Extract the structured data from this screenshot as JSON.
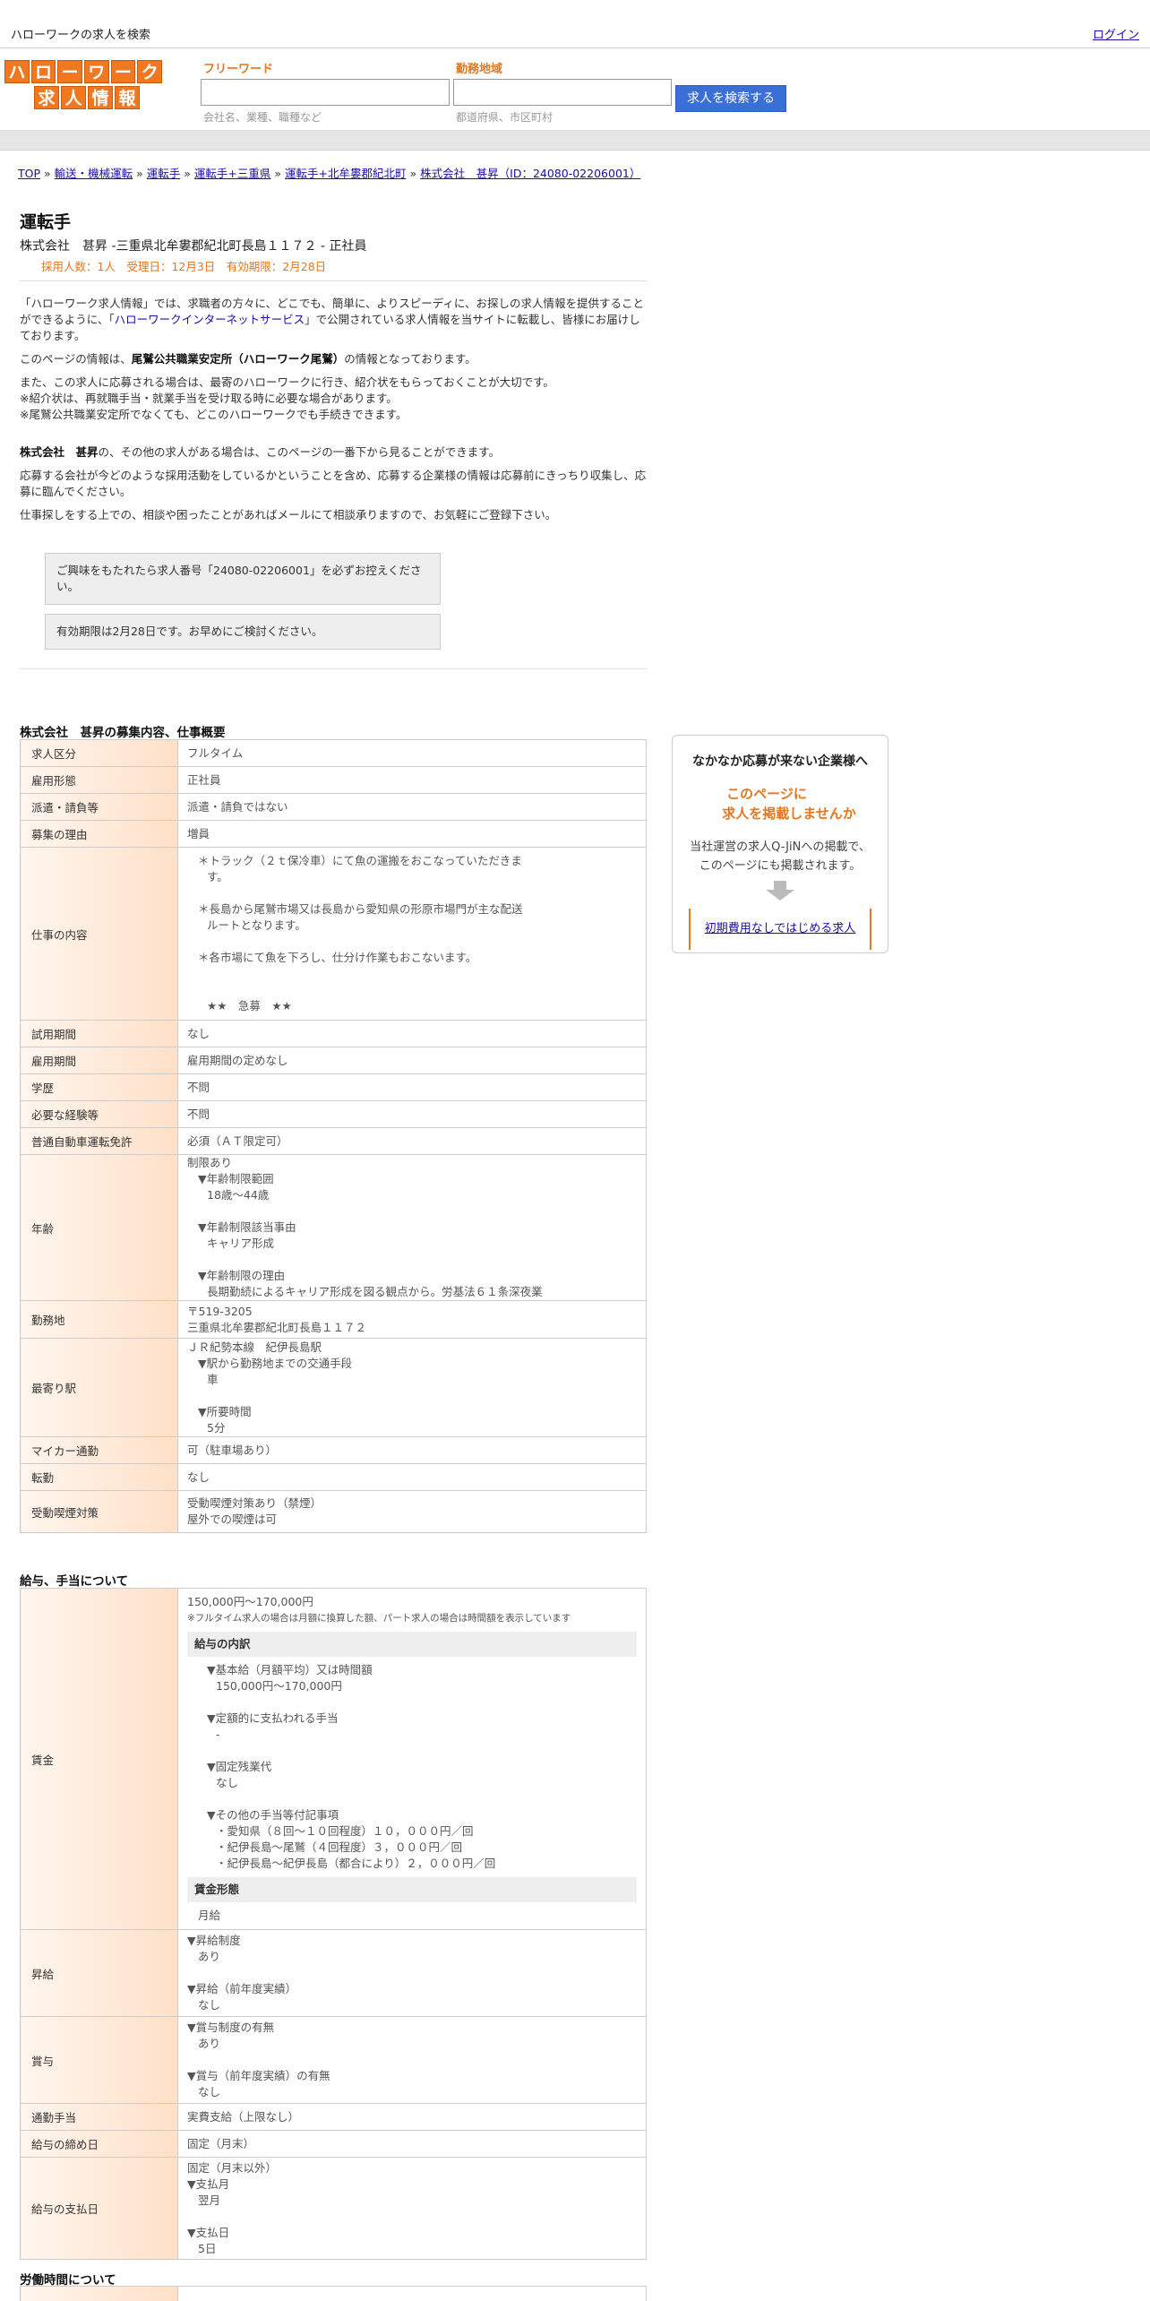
{
  "topbar": {
    "site_title": "ハローワークの求人を検索",
    "login": "ログイン"
  },
  "logo": {
    "row1": [
      "ハ",
      "ロ",
      "ー",
      "ワ",
      "ー",
      "ク"
    ],
    "row2": [
      "求",
      "人",
      "情",
      "報"
    ],
    "color": "#f07821"
  },
  "search": {
    "freeword_label": "フリーワード",
    "freeword_placeholder": "会社名、業種、職種など",
    "area_label": "勤務地域",
    "area_placeholder": "都道府県、市区町村",
    "button": "求人を検索する"
  },
  "breadcrumb": {
    "items": [
      "TOP",
      "輸送・機械運転",
      "運転手",
      "運転手+三重県",
      "運転手+北牟婁郡紀北町",
      "株式会社　甚昇（ID：24080-02206001）"
    ],
    "separator": "»"
  },
  "job": {
    "title": "運転手",
    "subtitle": "株式会社　甚昇 -三重県北牟婁郡紀北町長島１１７２ - 正社員",
    "meta": "採用人数：1人　受理日：12月3日　有効期限：2月28日"
  },
  "intro": {
    "p1_a": "「ハローワーク求人情報」では、求職者の方々に、どこでも、簡単に、よりスピーディに、お探しの求人情報を提供することができるように、「",
    "p1_link": "ハローワークインターネットサービス",
    "p1_b": "」で公開されている求人情報を当サイトに転載し、皆様にお届けしております。",
    "p2_a": "このページの情報は、",
    "p2_b": "尾鷲公共職業安定所（ハローワーク尾鷲）",
    "p2_c": "の情報となっております。",
    "p3_1": "また、この求人に応募される場合は、最寄のハローワークに行き、紹介状をもらっておくことが大切です。",
    "p3_2": "※紹介状は、再就職手当・就業手当を受け取る時に必要な場合があります。",
    "p3_3": "※尾鷲公共職業安定所でなくても、どこのハローワークでも手続きできます。",
    "p4_a": "株式会社　甚昇",
    "p4_b": "の、その他の求人がある場合は、このページの一番下から見ることができます。",
    "p5": "応募する会社が今どのような採用活動をしているかということを含め、応募する企業様の情報は応募前にきっちり収集し、応募に臨んでください。",
    "p6": "仕事探しをする上での、相談や困ったことがあればメールにて相談承りますので、お気軽にご登録下さい。"
  },
  "notes": {
    "n1": "ご興味をもたれたら求人番号「24080-02206001」を必ずお控えください。",
    "n2": "有効期限は2月28日です。お早めにご検討ください。"
  },
  "section1": {
    "title": "株式会社　甚昇の募集内容、仕事概要",
    "rows": {
      "kyujin_kubun": {
        "k": "求人区分",
        "v": "フルタイム"
      },
      "koyo_keitai": {
        "k": "雇用形態",
        "v": "正社員"
      },
      "haken": {
        "k": "派遣・請負等",
        "v": "派遣・請負ではない"
      },
      "riyu": {
        "k": "募集の理由",
        "v": "増員"
      },
      "shigoto": {
        "k": "仕事の内容",
        "l1": "＊トラック（２ｔ保冷車）にて魚の運搬をおこなっていただきま",
        "l2": "す。",
        "l3": "＊長島から尾鷲市場又は長島から愛知県の形原市場門が主な配送",
        "l4": "ルートとなります。",
        "l5": "＊各市場にて魚を下ろし、仕分け作業もおこないます。",
        "l6": "★★　急募　★★"
      },
      "shiyo": {
        "k": "試用期間",
        "v": "なし"
      },
      "koyo_kikan": {
        "k": "雇用期間",
        "v": "雇用期間の定めなし"
      },
      "gakureki": {
        "k": "学歴",
        "v": "不問"
      },
      "keiken": {
        "k": "必要な経験等",
        "v": "不問"
      },
      "menkyo": {
        "k": "普通自動車運転免許",
        "v": "必須（ＡＴ限定可）"
      },
      "nenrei": {
        "k": "年齢",
        "l1": "制限あり",
        "l2": "▼年齢制限範囲",
        "l3": "18歳〜44歳",
        "l4": "▼年齢制限該当事由",
        "l5": "キャリア形成",
        "l6": "▼年齢制限の理由",
        "l7": "長期勤続によるキャリア形成を図る観点から。労基法６１条深夜業"
      },
      "kinmuchi": {
        "k": "勤務地",
        "l1": "〒519-3205",
        "l2": "三重県北牟婁郡紀北町長島１１７２"
      },
      "eki": {
        "k": "最寄り駅",
        "l1": "ＪＲ紀勢本線　紀伊長島駅",
        "l2": "▼駅から勤務地までの交通手段",
        "l3": "車",
        "l4": "▼所要時間",
        "l5": "5分"
      },
      "mycar": {
        "k": "マイカー通勤",
        "v": "可（駐車場あり）"
      },
      "tenkin": {
        "k": "転勤",
        "v": "なし"
      },
      "kitsuen": {
        "k": "受動喫煙対策",
        "l1": "受動喫煙対策あり（禁煙）",
        "l2": "屋外での喫煙は可"
      }
    }
  },
  "section2": {
    "title": "給与、手当について",
    "chingin": {
      "k": "賃金",
      "l1": "150,000円〜170,000円",
      "note": "※フルタイム求人の場合は月額に換算した額、パート求人の場合は時間額を表示しています",
      "h1": "給与の内訳",
      "a1": "▼基本給（月額平均）又は時間額",
      "a2": "150,000円〜170,000円",
      "a3": "▼定額的に支払われる手当",
      "a4": "-",
      "a5": "▼固定残業代",
      "a6": "なし",
      "a7": "▼その他の手当等付記事項",
      "a8": "・愛知県（８回〜１０回程度）１０，０００円／回",
      "a9": "・紀伊長島〜尾鷲（４回程度）３，０００円／回",
      "a10": "・紀伊長島〜紀伊長島（都合により）２，０００円／回",
      "h2": "賃金形態",
      "b1": "月給"
    },
    "shokyu": {
      "k": "昇給",
      "l1": "▼昇給制度",
      "l2": "あり",
      "l3": "▼昇給（前年度実績）",
      "l4": "なし"
    },
    "shoyo": {
      "k": "賞与",
      "l1": "▼賞与制度の有無",
      "l2": "あり",
      "l3": "▼賞与（前年度実績）の有無",
      "l4": "なし"
    },
    "tsukin": {
      "k": "通勤手当",
      "v": "実費支給（上限なし）"
    },
    "shimebi": {
      "k": "給与の締め日",
      "v": "固定（月末）"
    },
    "shiharai": {
      "k": "給与の支払日",
      "l1": "固定（月末以外）",
      "l2": "▼支払月",
      "l3": "翌月",
      "l4": "▼支払日",
      "l5": "5日"
    }
  },
  "section3": {
    "title": "労働時間について"
  },
  "side": {
    "title": "なかなか応募が来ない企業様へ",
    "catch1": "このページに",
    "catch2": "求人を掲載しませんか",
    "desc1": "当社運営の求人Q-JiNへの掲載で、",
    "desc2": "このページにも掲載されます。",
    "link": "初期費用なしではじめる求人",
    "accent": "#e6761f"
  }
}
